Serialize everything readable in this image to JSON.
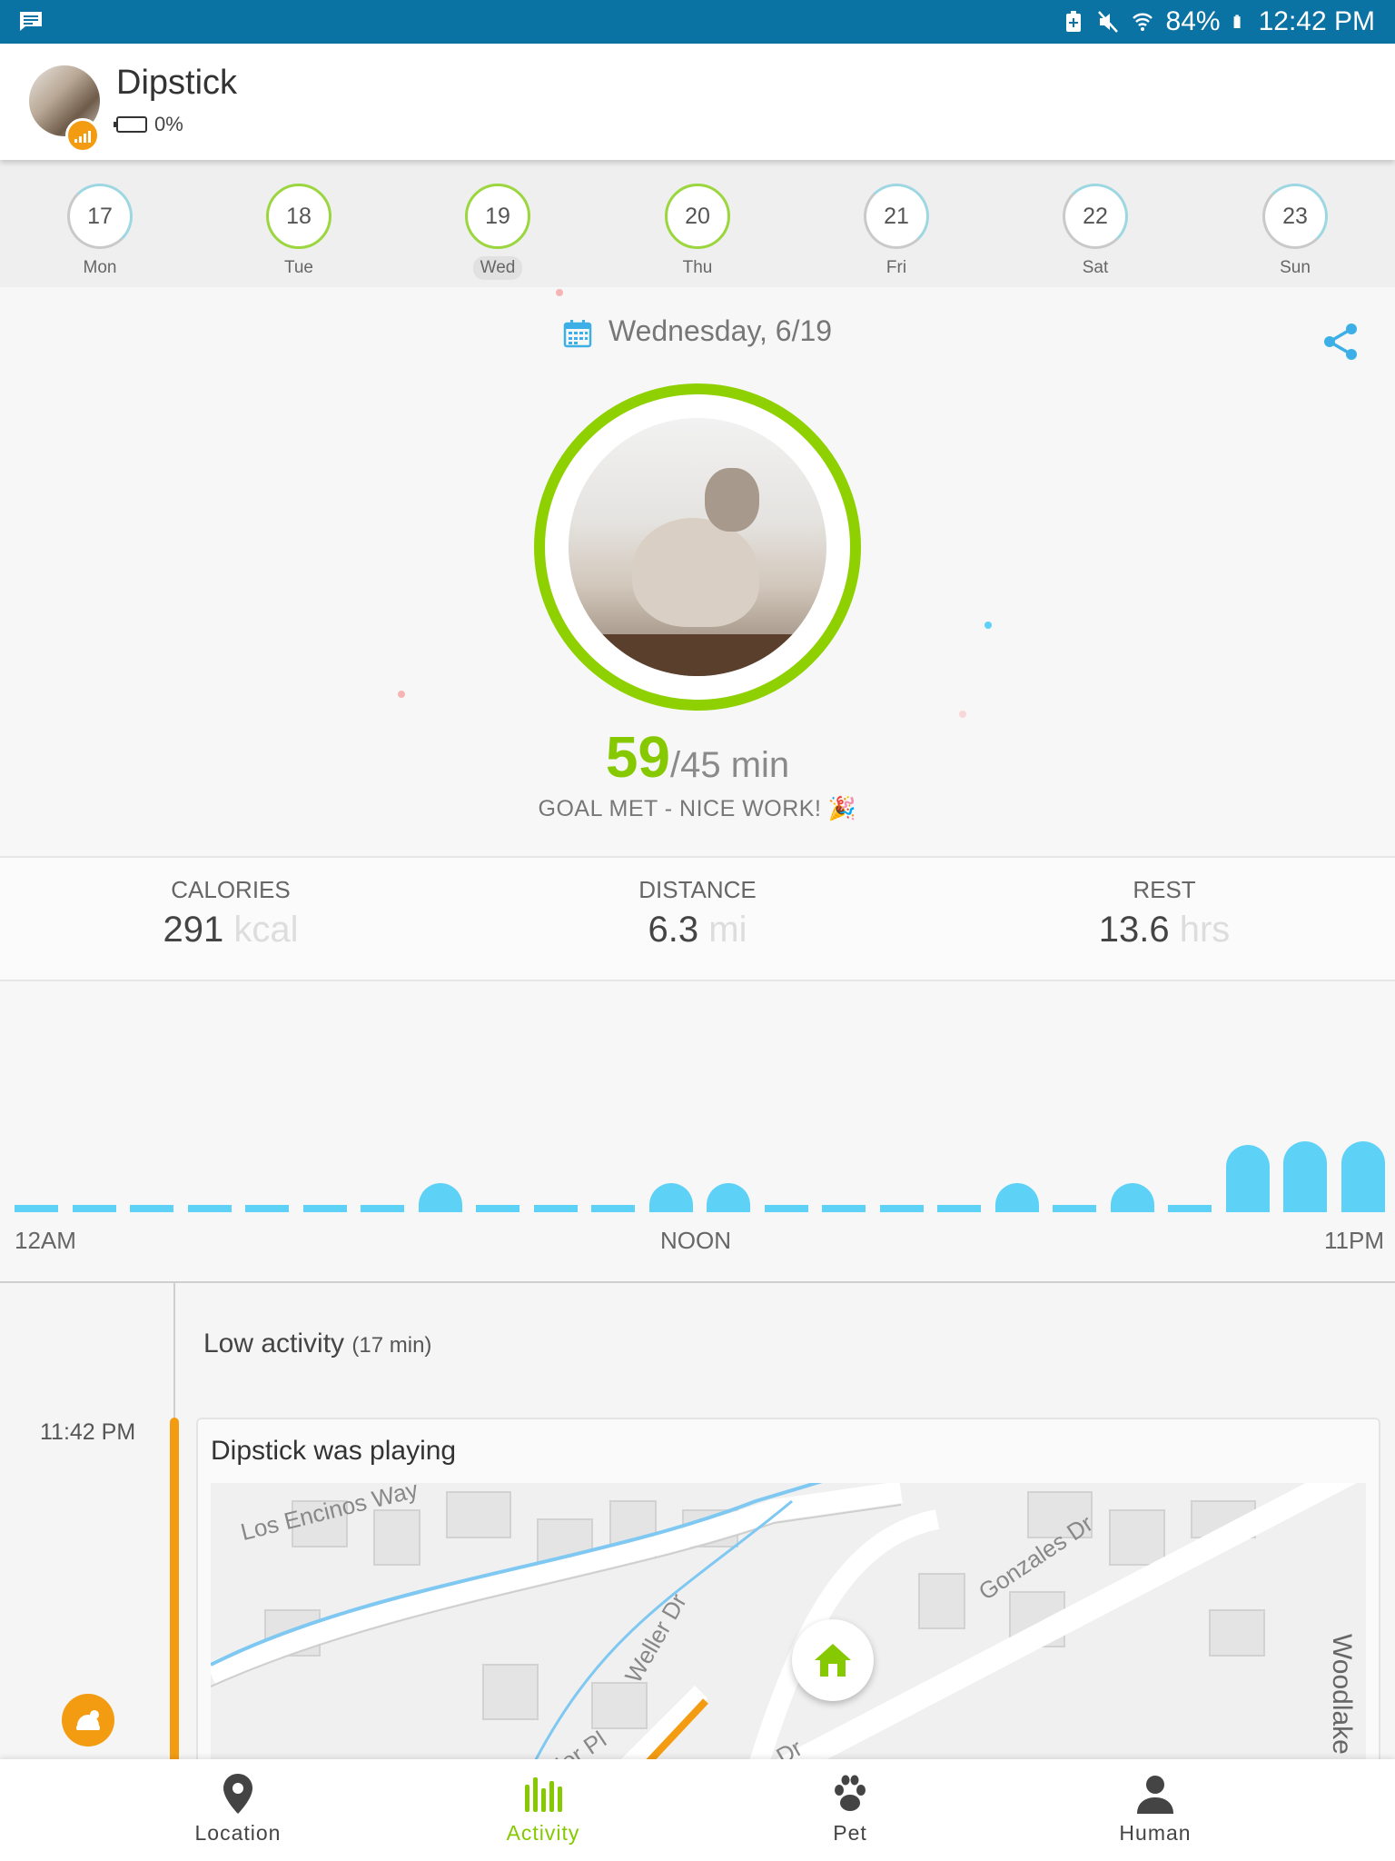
{
  "status_bar": {
    "battery": "84%",
    "time": "12:42 PM"
  },
  "header": {
    "pet_name": "Dipstick",
    "battery_level": "0%"
  },
  "week": [
    {
      "num": "17",
      "name": "Mon",
      "ring": "partial"
    },
    {
      "num": "18",
      "name": "Tue",
      "ring": "complete"
    },
    {
      "num": "19",
      "name": "Wed",
      "ring": "complete",
      "selected": true
    },
    {
      "num": "20",
      "name": "Thu",
      "ring": "complete"
    },
    {
      "num": "21",
      "name": "Fri",
      "ring": "partial"
    },
    {
      "num": "22",
      "name": "Sat",
      "ring": "partial"
    },
    {
      "num": "23",
      "name": "Sun",
      "ring": "partial"
    }
  ],
  "date_title": "Wednesday, 6/19",
  "goal": {
    "minutes": "59",
    "target": "/45 min",
    "message": "GOAL MET - NICE WORK! 🎉",
    "fraction": 1.0
  },
  "stats": [
    {
      "title": "CALORIES",
      "value": "291",
      "unit": "kcal"
    },
    {
      "title": "DISTANCE",
      "value": "6.3",
      "unit": "mi"
    },
    {
      "title": "REST",
      "value": "13.6",
      "unit": "hrs"
    }
  ],
  "activity_chart": {
    "axis_labels": [
      "12AM",
      "NOON",
      "11PM"
    ],
    "hourly_levels": [
      0,
      0,
      0,
      0,
      0,
      0,
      0,
      1,
      0,
      0,
      0,
      1,
      1,
      0,
      0,
      0,
      0,
      1,
      0,
      1,
      0,
      2,
      3,
      3
    ],
    "color": "#5ed1f7"
  },
  "timeline": {
    "group_label": "Low activity",
    "group_duration": "(17 min)",
    "event_time": "11:42 PM",
    "event_title": "Dipstick was playing",
    "map_labels": [
      "Los Encinos Way",
      "Gonzales Dr",
      "Weller Dr",
      "ler Pl",
      "s Dr",
      "Woodlake"
    ]
  },
  "bottom_nav": [
    {
      "label": "Location",
      "icon": "location-pin-icon"
    },
    {
      "label": "Activity",
      "icon": "activity-bars-icon",
      "active": true
    },
    {
      "label": "Pet",
      "icon": "paw-icon"
    },
    {
      "label": "Human",
      "icon": "person-icon"
    }
  ],
  "colors": {
    "accent_green": "#86c900",
    "accent_orange": "#f39c12",
    "status_bar": "#0a73a3",
    "chart_blue": "#5ed1f7"
  }
}
